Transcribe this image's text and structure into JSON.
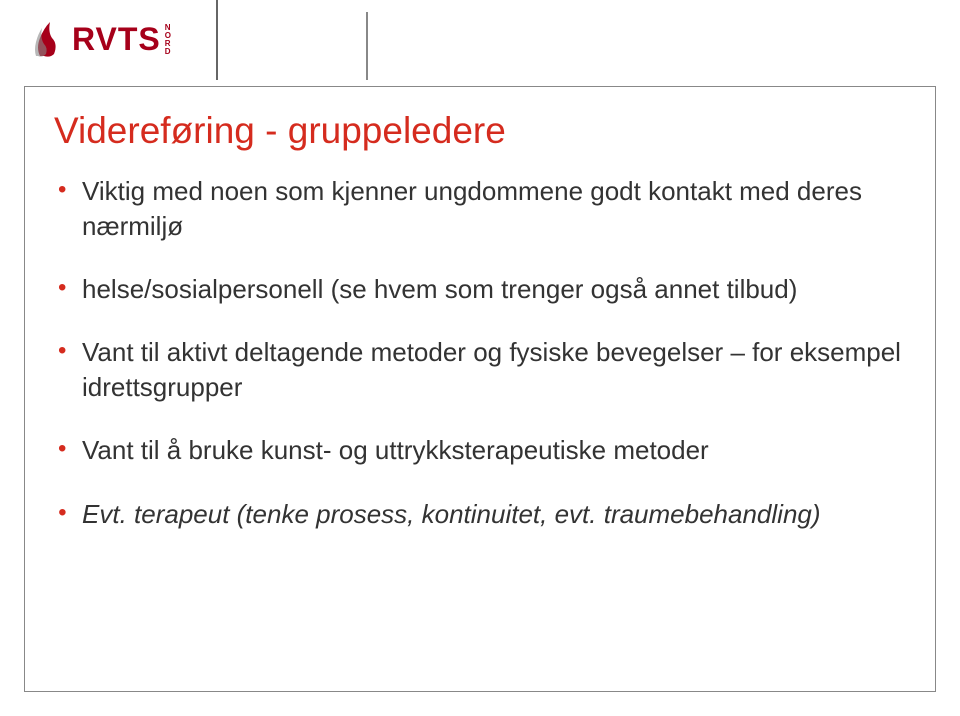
{
  "logo": {
    "text": "RVTS",
    "nord": [
      "N",
      "O",
      "R",
      "D"
    ]
  },
  "slide": {
    "title": "Videreføring - gruppeledere",
    "bullets": [
      {
        "text": "Viktig med noen som kjenner ungdommene godt kontakt med deres nærmiljø",
        "italic": false
      },
      {
        "text": "helse/sosialpersonell (se hvem som trenger også annet tilbud)",
        "italic": false
      },
      {
        "text": "Vant til aktivt deltagende metoder og fysiske bevegelser – for eksempel idrettsgrupper",
        "italic": false
      },
      {
        "text": "Vant til å bruke kunst- og uttrykksterapeutiske metoder",
        "italic": false
      },
      {
        "text": "Evt. terapeut (tenke prosess, kontinuitet, evt. traumebehandling)",
        "italic": true
      }
    ]
  }
}
